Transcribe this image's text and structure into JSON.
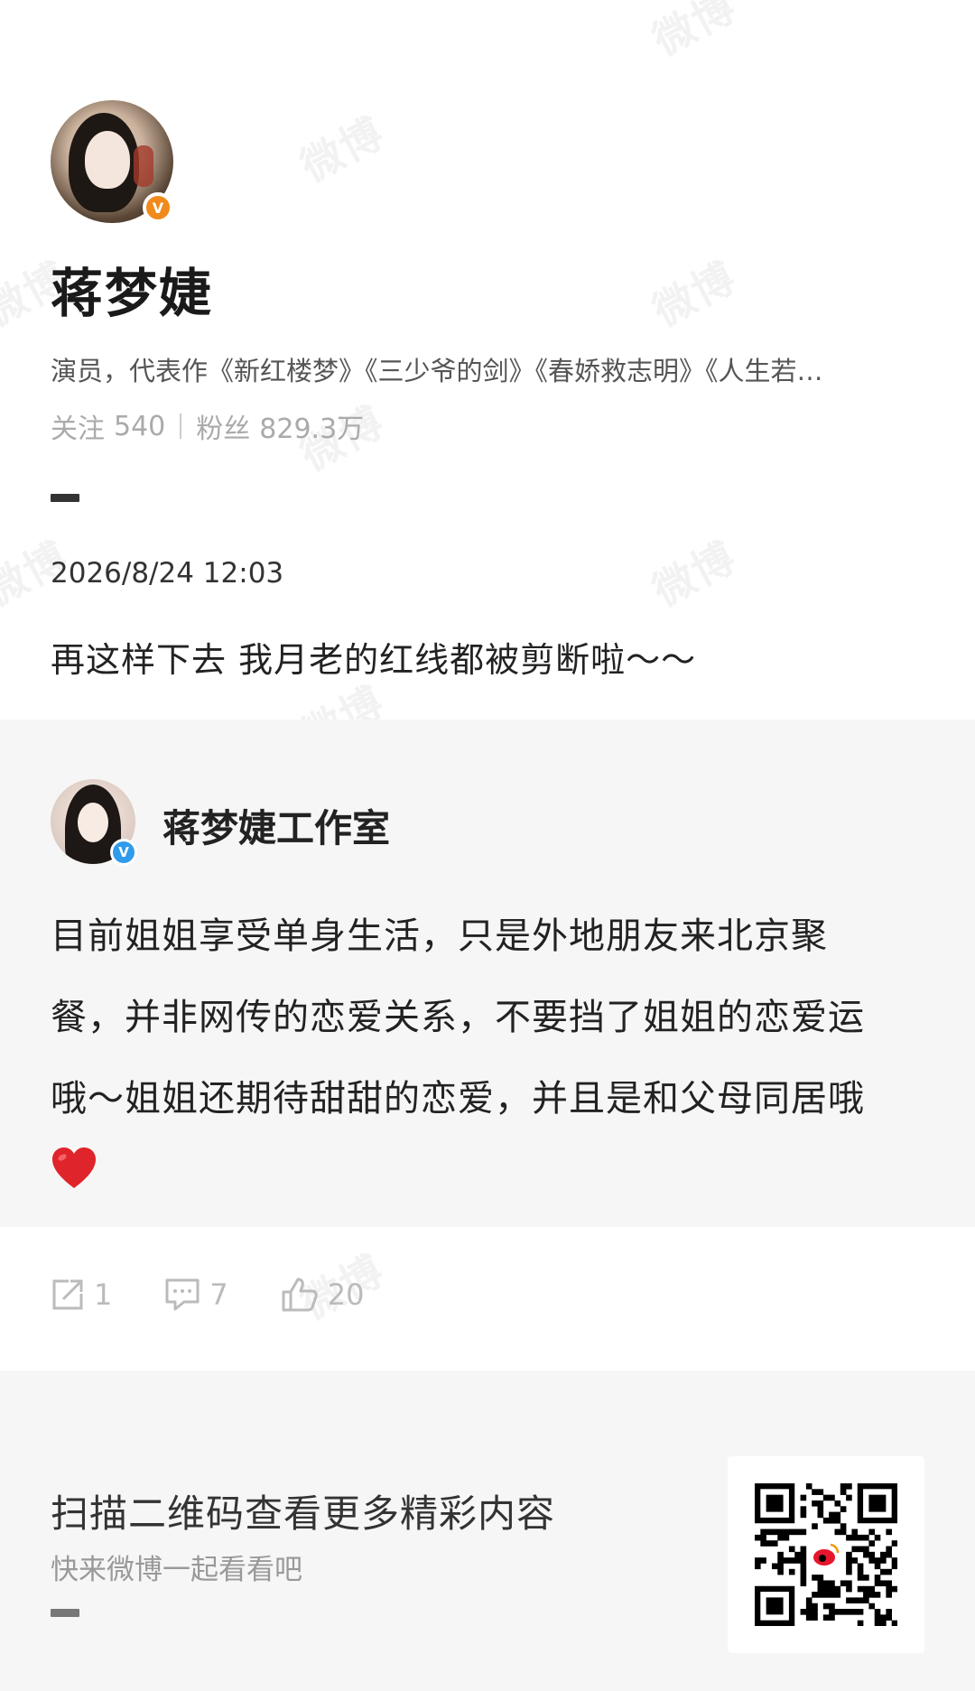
{
  "watermark": "微博",
  "profile": {
    "name": "蒋梦婕",
    "bio": "演员，代表作《新红楼梦》《三少爷的剑》《春娇救志明》《人生若…",
    "following_label": "关注",
    "following_count": "540",
    "followers_label": "粉丝",
    "followers_count": "829.3万",
    "verified_badge": "V"
  },
  "post": {
    "timestamp": "2026/8/24 12:03",
    "text": "再这样下去 我月老的红线都被剪断啦～～"
  },
  "repost": {
    "author": "蒋梦婕工作室",
    "verified_badge": "V",
    "lines": [
      "目前姐姐享受单身生活，只是外地朋友来北京聚",
      "餐，并非网传的恋爱关系，不要挡了姐姐的恋爱运",
      "哦～姐姐还期待甜甜的恋爱，并且是和父母同居哦"
    ],
    "emoji": "red-heart-icon"
  },
  "actions": {
    "share_count": "1",
    "comment_count": "7",
    "like_count": "20"
  },
  "footer": {
    "title": "扫描二维码查看更多精彩内容",
    "subtitle": "快来微博一起看看吧"
  },
  "colors": {
    "verified_orange": "#f08a1c",
    "verified_blue": "#2f9bea",
    "card_bg": "#f6f6f6",
    "heart_red": "#e0242b"
  }
}
